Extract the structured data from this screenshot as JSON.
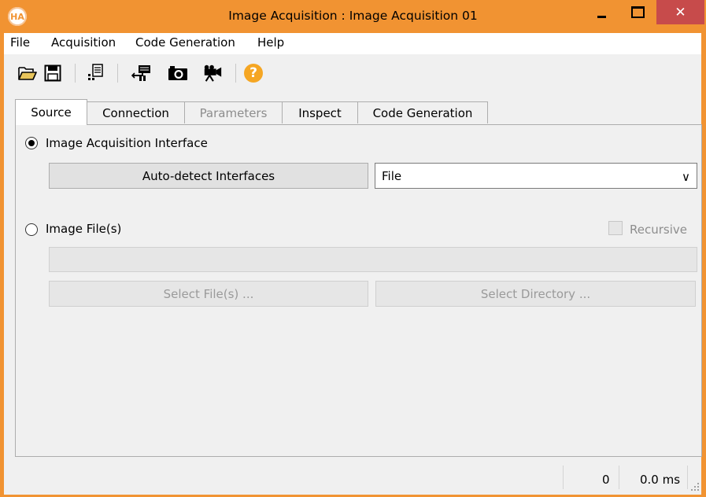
{
  "window": {
    "logo_text": "HA",
    "title": "Image Acquisition : Image Acquisition 01",
    "close_glyph": "✕"
  },
  "menu": [
    "File",
    "Acquisition",
    "Code Generation",
    "Help"
  ],
  "toolbar": {
    "icons": [
      "open-folder-icon",
      "save-disk-icon",
      "code-file-icon",
      "connect-icon",
      "camera-snap-icon",
      "live-video-icon",
      "help-icon"
    ],
    "help_glyph": "?",
    "accent": "#f5a623"
  },
  "tabs": [
    {
      "label": "Source",
      "state": "active"
    },
    {
      "label": "Connection",
      "state": "normal"
    },
    {
      "label": "Parameters",
      "state": "disabled"
    },
    {
      "label": "Inspect",
      "state": "normal"
    },
    {
      "label": "Code Generation",
      "state": "normal"
    }
  ],
  "source": {
    "interface_radio": {
      "label": "Image Acquisition Interface",
      "checked": true
    },
    "autodetect_label": "Auto-detect Interfaces",
    "interface_select": {
      "value": "File",
      "arrow": "∨"
    },
    "files_radio": {
      "label": "Image File(s)",
      "checked": false
    },
    "recursive": {
      "label": "Recursive",
      "checked": false,
      "enabled": false
    },
    "file_path": {
      "value": "",
      "placeholder": ""
    },
    "select_files_label": "Select File(s) ...",
    "select_directory_label": "Select Directory ..."
  },
  "status": {
    "count": "0",
    "time": "0.0 ms"
  },
  "colors": {
    "title_bar": "#f19332",
    "close_button": "#c74b4b"
  }
}
